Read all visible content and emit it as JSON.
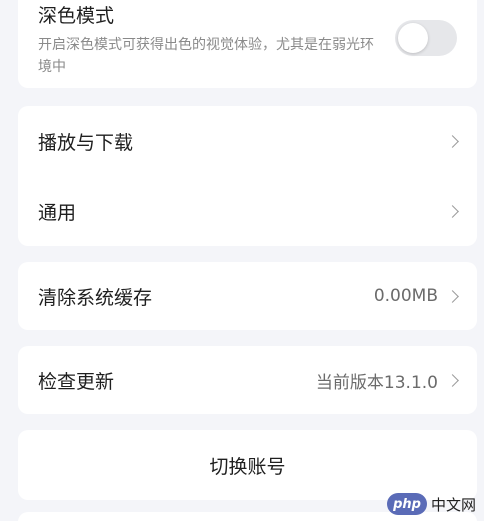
{
  "dark_mode": {
    "title": "深色模式",
    "description": "开启深色模式可获得出色的视觉体验，尤其是在弱光环境中",
    "enabled": false
  },
  "playback_group": {
    "items": [
      {
        "label": "播放与下载"
      },
      {
        "label": "通用"
      }
    ]
  },
  "cache": {
    "label": "清除系统缓存",
    "value": "0.00MB"
  },
  "update": {
    "label": "检查更新",
    "value": "当前版本13.1.0"
  },
  "switch_account": {
    "label": "切换账号"
  },
  "watermark": {
    "logo": "php",
    "text": "中文网"
  },
  "colors": {
    "background": "#f4f5f9",
    "card": "#ffffff",
    "toggle_off": "#e6e7ea",
    "watermark_logo": "#5a6bb7"
  },
  "icons": {
    "row_arrow": "chevron-right-icon"
  }
}
